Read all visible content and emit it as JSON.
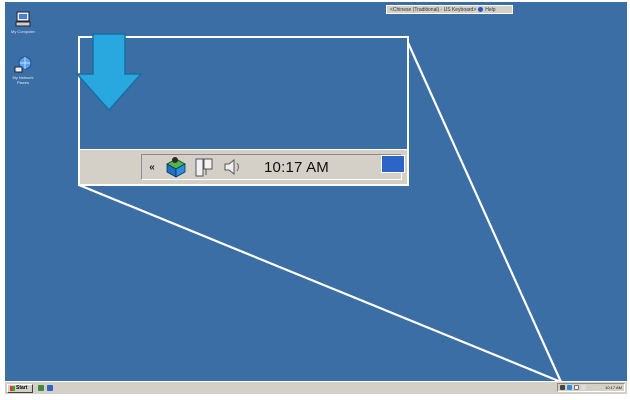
{
  "icons": {
    "desktop": [
      "my-computer-icon",
      "network-icon"
    ],
    "tray": [
      "expand-tray-icon",
      "app-tray-icon",
      "network-connection-icon",
      "volume-icon",
      "show-desktop-icon"
    ],
    "taskbar": [
      "start-flag-icon",
      "quick-launch-icon"
    ]
  },
  "lang_bar": {
    "text": "<Chinese (Traditional) - US Keyboard>",
    "help": "Help"
  },
  "desktop": {
    "items": [
      {
        "label": "My Computer"
      },
      {
        "label": "My Network Places"
      }
    ]
  },
  "zoom": {
    "tray": {
      "chevron": "«",
      "clock": "10:17 AM"
    }
  },
  "taskbar": {
    "start_label": "Start",
    "clock": "10:17 AM"
  },
  "colors": {
    "desktop": "#3a6ea5",
    "taskbar": "#d4d0c8",
    "callout_arrow": "#29a8e0",
    "callout_lines": "#ffffff"
  }
}
